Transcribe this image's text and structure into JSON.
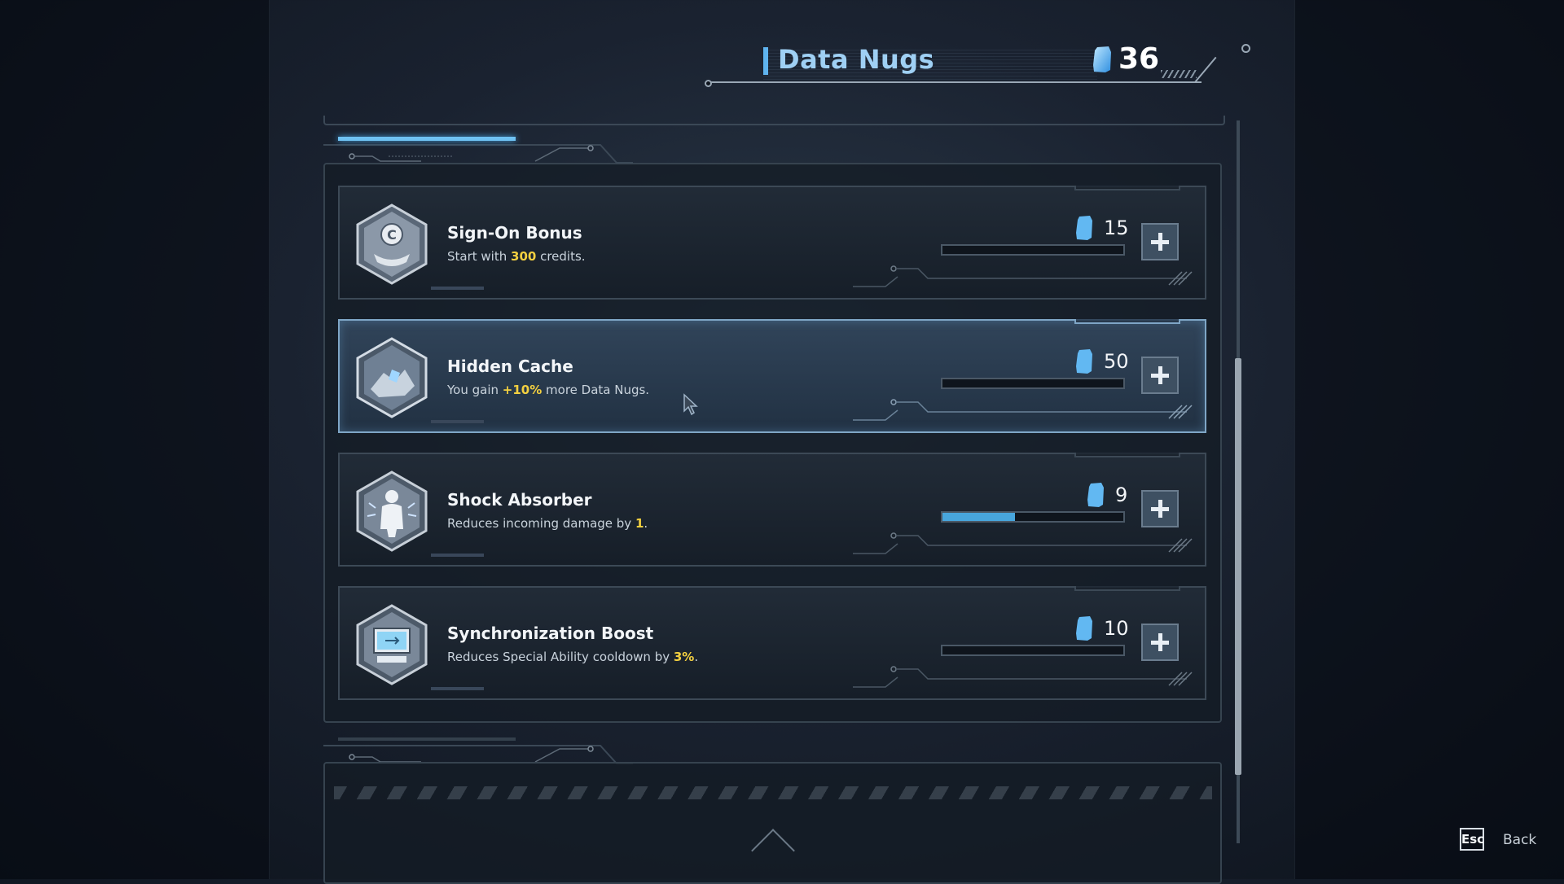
{
  "header": {
    "title": "Data Nugs",
    "balance": "36"
  },
  "perks": [
    {
      "name": "Sign-On Bonus",
      "desc_pre": "Start with ",
      "desc_hl": "300",
      "desc_post": " credits.",
      "cost": "15",
      "progress": 0,
      "selected": false
    },
    {
      "name": "Hidden Cache",
      "desc_pre": "You gain ",
      "desc_hl": "+10%",
      "desc_post": " more Data Nugs.",
      "cost": "50",
      "progress": 0,
      "selected": true
    },
    {
      "name": "Shock Absorber",
      "desc_pre": "Reduces incoming damage by ",
      "desc_hl": "1",
      "desc_post": ".",
      "cost": "9",
      "progress": 0.4,
      "selected": false
    },
    {
      "name": "Synchronization Boost",
      "desc_pre": "Reduces Special Ability cooldown by ",
      "desc_hl": "3%",
      "desc_post": ".",
      "cost": "10",
      "progress": 0,
      "selected": false
    }
  ],
  "footer": {
    "esc_key": "Esc",
    "back_label": "Back"
  },
  "colors": {
    "accent": "#5fb4ef",
    "highlight": "#f3d040",
    "progress": "#48a6dd"
  },
  "icons": [
    "data-nug-icon",
    "credits-hand-icon",
    "hidden-cache-icon",
    "shock-absorber-icon",
    "sync-computer-icon",
    "plus-icon"
  ]
}
